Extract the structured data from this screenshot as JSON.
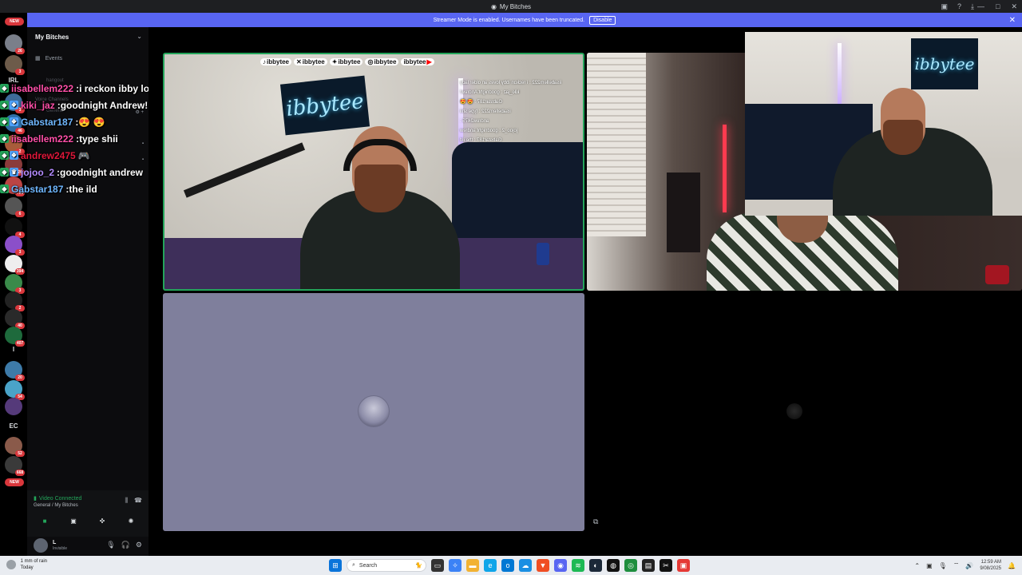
{
  "window": {
    "title": "My Bitches",
    "app_icon": "discord-icon"
  },
  "banner": {
    "message": "Streamer Mode is enabled. Usernames have been truncated.",
    "button": "Disable"
  },
  "rail": {
    "new_top": "NEW",
    "new_bottom": "NEW",
    "text_irl": "IRL",
    "text_i": "I",
    "text_ec": "EC",
    "badges": [
      "26",
      "3",
      "3",
      "46",
      "2",
      "26",
      "795",
      "6",
      "4",
      "3",
      "394",
      "3",
      "2",
      "40",
      "407",
      "20",
      "54",
      "52",
      "3",
      "1K+",
      "668",
      "3"
    ]
  },
  "sidebar": {
    "server_name": "My Bitches",
    "events_label": "Events",
    "faint_hangout": "hangout",
    "faint_voice": "Voice Channels",
    "faint_general": "General"
  },
  "chat": [
    {
      "user": "iisabellem222",
      "sep": " : ",
      "text": "i reckon ibby loves an older lady",
      "color": "#ff4fa8",
      "badges": [
        "◆"
      ]
    },
    {
      "user": "kiki_jaz",
      "sep": " : ",
      "text": "goodnight Andrew!",
      "color": "#ff4fa8",
      "badges": [
        "◆",
        "❖"
      ]
    },
    {
      "user": "Gabstar187",
      "sep": " : ",
      "text": "😍 😍",
      "color": "#6fb7ff",
      "badges": [
        "◆",
        "❖"
      ]
    },
    {
      "user": "iisabellem222",
      "sep": " : ",
      "text": "type shii",
      "color": "#ff4fa8",
      "badges": [
        "◆"
      ]
    },
    {
      "user": "andrew2475",
      "sep": "",
      "text": "🎮",
      "color": "#e0173a",
      "badges": [
        "◆",
        "❖"
      ]
    },
    {
      "user": "jojoo_2",
      "sep": " : ",
      "text": "goodnight andrew",
      "color": "#b48cff",
      "badges": [
        "◆",
        "♛"
      ]
    },
    {
      "user": "Gabstar187",
      "sep": " : ",
      "text": "the ild",
      "color": "#6fb7ff",
      "badges": [
        "◆"
      ]
    }
  ],
  "voice": {
    "status": "Video Connected",
    "channel": "General / My Bitches"
  },
  "user": {
    "name": "L",
    "status": "Invisible"
  },
  "stream": {
    "neon_text": "ibbytee",
    "socials": [
      "ibbytee",
      "ibbytee",
      "ibbytee",
      "ibbytee",
      "ibbytee"
    ],
    "mini_chat": [
      "iisabellem222 : i reckon ibby loves an older lady",
      "kiki_jaz : goodnight Andrew!",
      "Gabstar187 : 😍 😍",
      "iisabellem222 : type shii",
      "andrew2475 :",
      "jojoo_2 : goodnight andrew",
      "Gabstar187 : the ild"
    ]
  },
  "taskbar": {
    "weather_line1": "1 mm of rain",
    "weather_line2": "Today",
    "weather_badge": "1",
    "search_placeholder": "Search",
    "time": "12:59 AM",
    "date": "9/08/2025"
  },
  "colors": {
    "accent": "#5865f2",
    "live_border": "#23a55a",
    "badge_red": "#da373c"
  }
}
